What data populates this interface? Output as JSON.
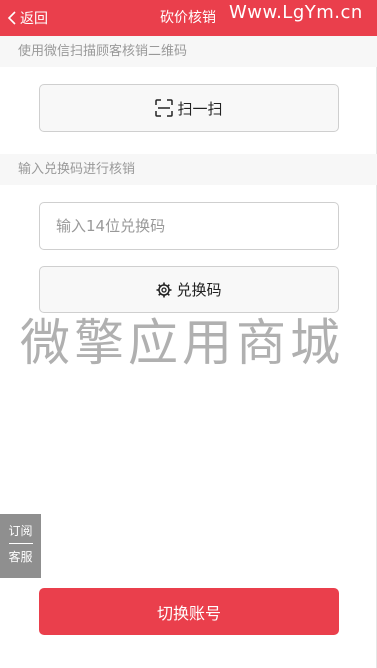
{
  "header": {
    "back_label": "返回",
    "title": "砍价核销",
    "watermark": "Www.LgYm.cn",
    "background": "#ea3f4c"
  },
  "scan_section": {
    "label": "使用微信扫描顾客核销二维码",
    "button_label": "扫一扫",
    "button_icon": "scan-icon"
  },
  "code_section": {
    "label": "输入兑换码进行核销",
    "input_placeholder": "输入14位兑换码",
    "input_value": "",
    "button_label": "兑换码",
    "button_icon": "gear-icon"
  },
  "watermark_text": "微擎应用商城",
  "side_tab": {
    "top": "订阅",
    "bottom": "客服"
  },
  "footer": {
    "switch_label": "切换账号",
    "accent": "#ea3f4c"
  }
}
